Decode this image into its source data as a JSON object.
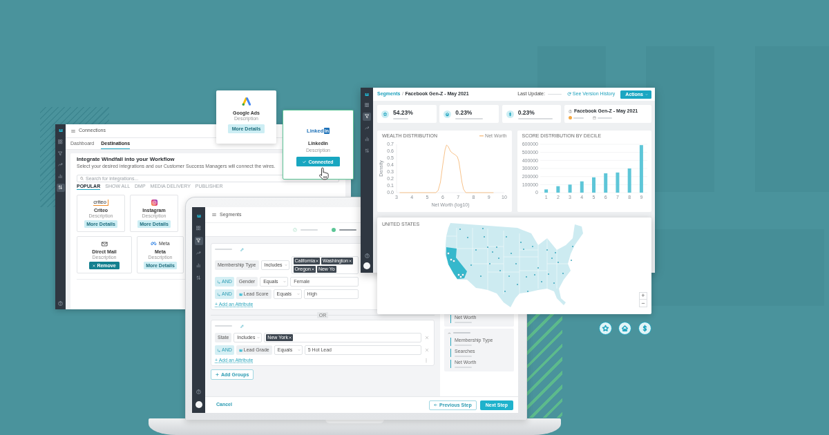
{
  "connections_window": {
    "nav_items": [
      {
        "kind": "grid",
        "selected": false
      },
      {
        "kind": "funnel",
        "selected": false
      },
      {
        "kind": "trend",
        "selected": false
      },
      {
        "kind": "bars",
        "selected": false
      },
      {
        "kind": "transfer",
        "selected": true
      }
    ],
    "title": "Connections",
    "tabs": [
      {
        "label": "Dashboard",
        "selected": false
      },
      {
        "label": "Destinations",
        "selected": true
      }
    ],
    "heading": "Integrate Windfall into your Workflow",
    "subheading": "Select your desired integrations and our Customer Success Managers will connect the wires.",
    "search": {
      "placeholder": "Search for integrations..."
    },
    "filters": [
      {
        "label": "POPULAR",
        "selected": true
      },
      {
        "label": "SHOW ALL",
        "selected": false
      },
      {
        "label": "DMP",
        "selected": false
      },
      {
        "label": "MEDIA DELIVERY",
        "selected": false
      },
      {
        "label": "PUBLISHER",
        "selected": false
      }
    ],
    "integrations": [
      {
        "kind": "criteo",
        "logo_text": "criteo",
        "name": "Criteo",
        "description": "Description",
        "button": {
          "label": "More Details",
          "kind": "details"
        }
      },
      {
        "kind": "instagram",
        "name": "Instagram",
        "description": "Description",
        "button": {
          "label": "More Details",
          "kind": "details"
        }
      },
      {
        "kind": "mail",
        "name": "Direct Mail",
        "description": "Description",
        "button": {
          "label": "Remove",
          "kind": "remove"
        }
      },
      {
        "kind": "meta",
        "logo_text": "Meta",
        "name": "Meta",
        "description": "Description",
        "button": {
          "label": "More Details",
          "kind": "details"
        }
      }
    ]
  },
  "integration_popups": [
    {
      "kind": "google_ads",
      "name": "Google Ads",
      "description": "Description",
      "button": {
        "label": "More Details",
        "kind": "details"
      },
      "selected": false
    },
    {
      "kind": "linkedin",
      "logo_text": "Linked",
      "logo_badge": "in",
      "name": "Linkedin",
      "description": "Description",
      "button": {
        "label": "Connected",
        "kind": "connected"
      },
      "selected": true
    }
  ],
  "segments_window": {
    "nav_items": [
      {
        "kind": "grid",
        "selected": false
      },
      {
        "kind": "funnel",
        "selected": true
      },
      {
        "kind": "trend",
        "selected": false
      },
      {
        "kind": "bars",
        "selected": false
      },
      {
        "kind": "transfer",
        "selected": false
      }
    ],
    "title": "Segments",
    "steps": [
      {
        "done": true,
        "selected": false
      },
      {
        "done": false,
        "selected": true
      }
    ],
    "groups": [
      {
        "rows": [
          {
            "kind": "tags",
            "attribute": "Membership Type",
            "attribute_icon": false,
            "operator": "Includes",
            "tags": [
              {
                "label": "California",
                "remove_icon": true
              },
              {
                "label": "Washington",
                "remove_icon": true
              },
              {
                "label": "Oregon",
                "remove_icon": true
              },
              {
                "label": "New Yo",
                "remove_icon": false
              }
            ],
            "removable": false
          },
          {
            "kind": "text",
            "connector": "AND",
            "attribute": "Gender",
            "attribute_icon": false,
            "operator": "Equals",
            "value": "Female",
            "removable": false
          },
          {
            "kind": "text",
            "connector": "AND",
            "attribute": "Lead Score",
            "attribute_icon": true,
            "operator": "Equals",
            "value": "High",
            "removable": false
          }
        ],
        "add_attribute": "+ Add an Attribute",
        "menu": false
      },
      {
        "rows": [
          {
            "kind": "tags",
            "attribute": "State",
            "attribute_icon": false,
            "operator": "Includes",
            "tags": [
              {
                "label": "New York",
                "remove_icon": true
              }
            ],
            "removable": true
          },
          {
            "kind": "text",
            "connector": "AND",
            "attribute": "Lead Grade",
            "attribute_icon": true,
            "operator": "Equals",
            "value": "5 Hot Lead",
            "removable": true
          }
        ],
        "add_attribute": "+ Add an Attribute",
        "menu": true
      }
    ],
    "separator": "OR",
    "add_groups": "Add Groups",
    "side_panel": {
      "items_above": [
        {
          "label": "Net Worth"
        }
      ],
      "section": {
        "expanded": true,
        "items": [
          {
            "label": "Membership Type"
          },
          {
            "label": "Searches"
          },
          {
            "label": "Net Worth"
          }
        ]
      }
    },
    "footer": {
      "cancel": "Cancel",
      "previous": "Previous Step",
      "next": "Next Step"
    }
  },
  "dashboard_window": {
    "nav_items": [
      {
        "kind": "grid",
        "selected": false
      },
      {
        "kind": "funnel",
        "selected": true
      },
      {
        "kind": "trend",
        "selected": false
      },
      {
        "kind": "bars",
        "selected": false
      },
      {
        "kind": "transfer",
        "selected": false
      }
    ],
    "breadcrumb": [
      {
        "label": "Segments",
        "kind": "link"
      },
      {
        "label": "Facebook Gen-Z - May 2021",
        "kind": "current"
      }
    ],
    "breadcrumb_separator": "/",
    "last_update_label": "Last Update:",
    "version_link": "See Version History",
    "actions_button": "Actions",
    "stats": [
      {
        "kind": "star",
        "value": "54.23%"
      },
      {
        "kind": "home",
        "value": "0.23%"
      },
      {
        "kind": "dollar",
        "value": "0.23%"
      }
    ],
    "summary_title": "Facebook Gen-Z - May 2021",
    "wealth_chart": {
      "chart_data": {
        "type": "line",
        "title": "WEALTH DISTRIBUTION",
        "xlabel": "Net Worth (log10)",
        "ylabel": "Density",
        "x": [
          3.2,
          5.55,
          5.7,
          5.85,
          6.0,
          6.15,
          6.25,
          6.35,
          6.5,
          6.65,
          6.8,
          6.95,
          7.05,
          7.15,
          7.25,
          7.35,
          7.5,
          9.3
        ],
        "series": [
          {
            "name": "Net Worth",
            "color": "#f8c38b",
            "values": [
              0,
              0,
              0.03,
              0.15,
              0.4,
              0.62,
              0.69,
              0.67,
              0.6,
              0.57,
              0.55,
              0.52,
              0.45,
              0.3,
              0.15,
              0.05,
              0,
              0
            ]
          }
        ],
        "xlim": [
          3,
          10
        ],
        "ylim": [
          0,
          0.7
        ],
        "xticks": [
          3,
          4,
          5,
          6,
          7,
          8,
          9,
          10
        ],
        "yticks": [
          {
            "value": 0,
            "label": "0.0"
          },
          {
            "value": 0.1,
            "label": "0.1"
          },
          {
            "value": 0.2,
            "label": "0.2"
          },
          {
            "value": 0.3,
            "label": "0.3"
          },
          {
            "value": 0.4,
            "label": "0.4"
          },
          {
            "value": 0.5,
            "label": "0.5"
          },
          {
            "value": 0.6,
            "label": "0.6"
          },
          {
            "value": 0.7,
            "label": "0.7"
          }
        ]
      }
    },
    "score_chart": {
      "chart_data": {
        "type": "bar",
        "title": "SCORE DISTRIBUTION BY DECILE",
        "categories": [
          "1",
          "2",
          "3",
          "4",
          "5",
          "6",
          "7",
          "8",
          "9"
        ],
        "values": [
          40000,
          80000,
          100000,
          140000,
          190000,
          240000,
          250000,
          300000,
          590000
        ],
        "ylim": [
          0,
          600000
        ],
        "yticks": [
          0,
          100000,
          200000,
          300000,
          400000,
          500000,
          600000
        ],
        "grid": true
      }
    }
  },
  "map_card": {
    "title": "UNITED STATES",
    "zoom_in": "+",
    "zoom_out": "−"
  }
}
